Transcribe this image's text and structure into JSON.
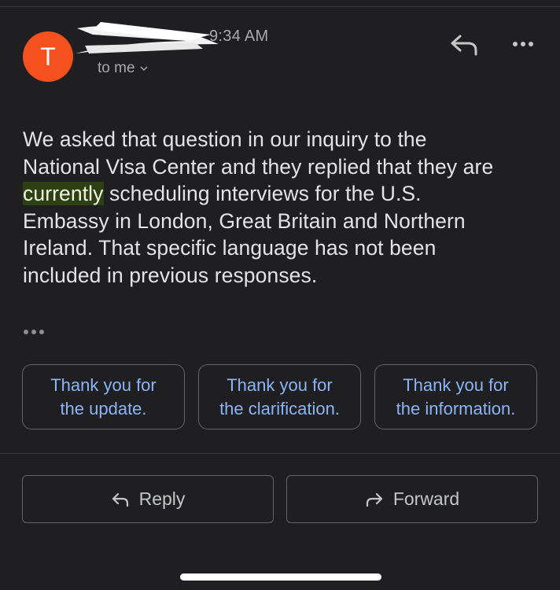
{
  "header": {
    "avatar_letter": "T",
    "time": "9:34 AM",
    "recipient": "to me",
    "reply_icon": "reply-icon",
    "more_icon": "more-horizontal-icon"
  },
  "message": {
    "lines": [
      "We asked that question in our inquiry to the",
      "National Visa Center and they replied that they are"
    ],
    "highlight_word": "currently",
    "line3_rest": "  scheduling interviews for the U.S.",
    "lines_after": [
      "Embassy in London, Great Britain and Northern",
      "Ireland.  That specific language has not been",
      "included in previous responses."
    ],
    "trimmed_icon": "ellipsis-icon"
  },
  "smart_replies": [
    {
      "line1": "Thank you for",
      "line2": "the update."
    },
    {
      "line1": "Thank you for",
      "line2": "the clarification."
    },
    {
      "line1": "Thank you for",
      "line2": "the information."
    }
  ],
  "actions": {
    "reply_label": "Reply",
    "forward_label": "Forward",
    "reply_icon": "reply-arrow-icon",
    "forward_icon": "forward-arrow-icon"
  },
  "colors": {
    "background": "#1f1f21",
    "avatar": "#f4511e",
    "smart_reply_text": "#8ab4f8",
    "highlight": "#2d4014"
  }
}
